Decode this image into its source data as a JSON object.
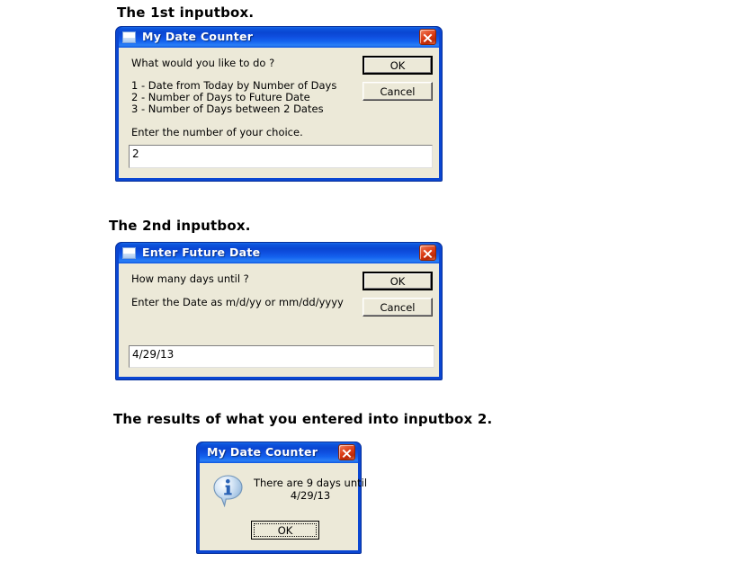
{
  "page": {
    "captions": [
      "The 1st inputbox.",
      "The 2nd inputbox.",
      "The results of what you entered into inputbox 2."
    ]
  },
  "colors": {
    "titlebar_blue": "#0a46d2",
    "window_border": "#06309a",
    "client_face": "#ece9d8",
    "close_red": "#d8360f",
    "info_blue": "#2a62b5"
  },
  "dialog1": {
    "title": "My Date Counter",
    "window_icon": "document-icon",
    "close_icon": "close-icon",
    "prompt": "What would you like to do ?",
    "options": [
      "1 - Date from Today by Number of Days",
      "2 - Number of Days to Future Date",
      "3 - Number of Days between 2 Dates"
    ],
    "instruction": "Enter the number of your choice.",
    "input_value": "2",
    "ok_label": "OK",
    "cancel_label": "Cancel"
  },
  "dialog2": {
    "title": "Enter Future Date",
    "window_icon": "document-icon",
    "close_icon": "close-icon",
    "prompt": "How many days until ?",
    "instruction": "Enter the Date as m/d/yy or mm/dd/yyyy",
    "input_value": "4/29/13",
    "ok_label": "OK",
    "cancel_label": "Cancel"
  },
  "messagebox": {
    "title": "My Date Counter",
    "close_icon": "close-icon",
    "icon": "info-icon",
    "message_line1": "There are 9 days until",
    "message_line2": "4/29/13",
    "ok_label": "OK"
  }
}
